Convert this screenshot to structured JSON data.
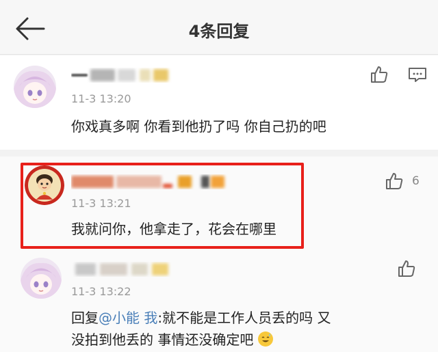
{
  "header": {
    "title": "4条回复"
  },
  "comments": [
    {
      "time": "11-3 13:20",
      "text": "你戏真多啊 你看到他扔了吗 你自己扔的吧"
    },
    {
      "time": "11-3 13:21",
      "text": "我就问你，他拿走了，花会在哪里",
      "likes": "6",
      "highlighted": true
    },
    {
      "time": "11-3 13:22",
      "reply_prefix": "回复",
      "mention": "@小能    我",
      "text_line1": ":就不能是工作人员丢的吗 又",
      "text_line2": "没拍到他丢的 事情还没确定吧"
    }
  ],
  "colors": {
    "highlight_border": "#e8201a",
    "mention": "#4a7fb8",
    "time": "#999999"
  },
  "icons": {
    "back": "back-arrow-icon",
    "like": "thumbs-up-icon",
    "reply": "comment-bubble-icon",
    "emoji": "sweat-smile-emoji"
  }
}
